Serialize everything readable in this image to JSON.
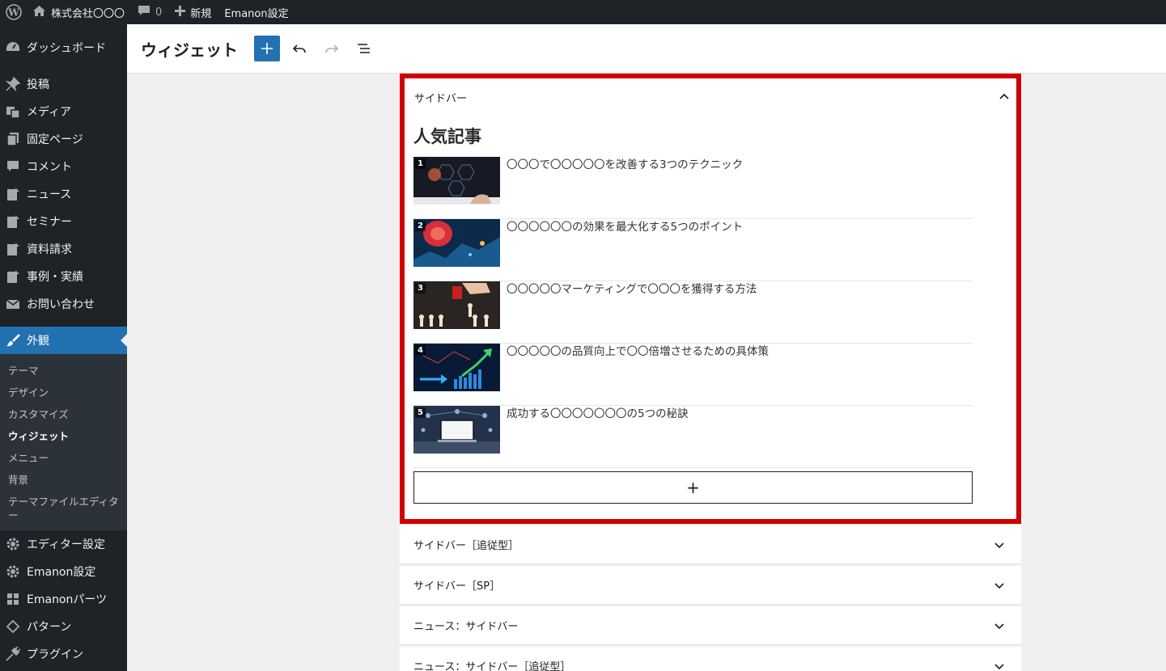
{
  "admin_bar": {
    "site_name": "株式会社〇〇〇",
    "comments_count": "0",
    "new_label": "新規",
    "theme_settings": "Emanon設定"
  },
  "sidebar": {
    "items": [
      {
        "label": "ダッシュボード",
        "icon": "dashboard-icon"
      },
      {
        "label": "投稿",
        "icon": "pin-icon"
      },
      {
        "label": "メディア",
        "icon": "media-icon"
      },
      {
        "label": "固定ページ",
        "icon": "pages-icon"
      },
      {
        "label": "コメント",
        "icon": "comment-icon"
      },
      {
        "label": "ニュース",
        "icon": "post-icon"
      },
      {
        "label": "セミナー",
        "icon": "post-icon"
      },
      {
        "label": "資料請求",
        "icon": "post-icon"
      },
      {
        "label": "事例・実績",
        "icon": "post-icon"
      },
      {
        "label": "お問い合わせ",
        "icon": "mail-icon"
      },
      {
        "label": "外観",
        "icon": "brush-icon"
      }
    ],
    "appearance_sub": [
      "テーマ",
      "デザイン",
      "カスタマイズ",
      "ウィジェット",
      "メニュー",
      "背景",
      "テーマファイルエディター"
    ],
    "items_after": [
      {
        "label": "エディター設定",
        "icon": "gear-icon"
      },
      {
        "label": "Emanon設定",
        "icon": "gear-icon"
      },
      {
        "label": "Emanonパーツ",
        "icon": "grid-icon"
      },
      {
        "label": "パターン",
        "icon": "pattern-icon"
      },
      {
        "label": "プラグイン",
        "icon": "plugin-icon"
      }
    ]
  },
  "editor": {
    "title": "ウィジェット"
  },
  "open_area": {
    "label": "サイドバー",
    "widget_title": "人気記事",
    "posts": [
      {
        "rank": "1",
        "title": "〇〇〇で〇〇〇〇〇を改善する3つのテクニック"
      },
      {
        "rank": "2",
        "title": "〇〇〇〇〇〇の効果を最大化する5つのポイント"
      },
      {
        "rank": "3",
        "title": "〇〇〇〇〇マーケティングで〇〇〇を獲得する方法"
      },
      {
        "rank": "4",
        "title": "〇〇〇〇〇の品質向上で〇〇倍増させるための具体策"
      },
      {
        "rank": "5",
        "title": "成功する〇〇〇〇〇〇〇の5つの秘訣"
      }
    ],
    "add_block": "+"
  },
  "closed_areas": [
    "サイドバー［追従型］",
    "サイドバー［SP］",
    "ニュース：サイドバー",
    "ニュース：サイドバー［追従型］"
  ],
  "colors": {
    "admin_bg": "#1d2327",
    "accent": "#2271b1",
    "highlight": "#d10000"
  }
}
